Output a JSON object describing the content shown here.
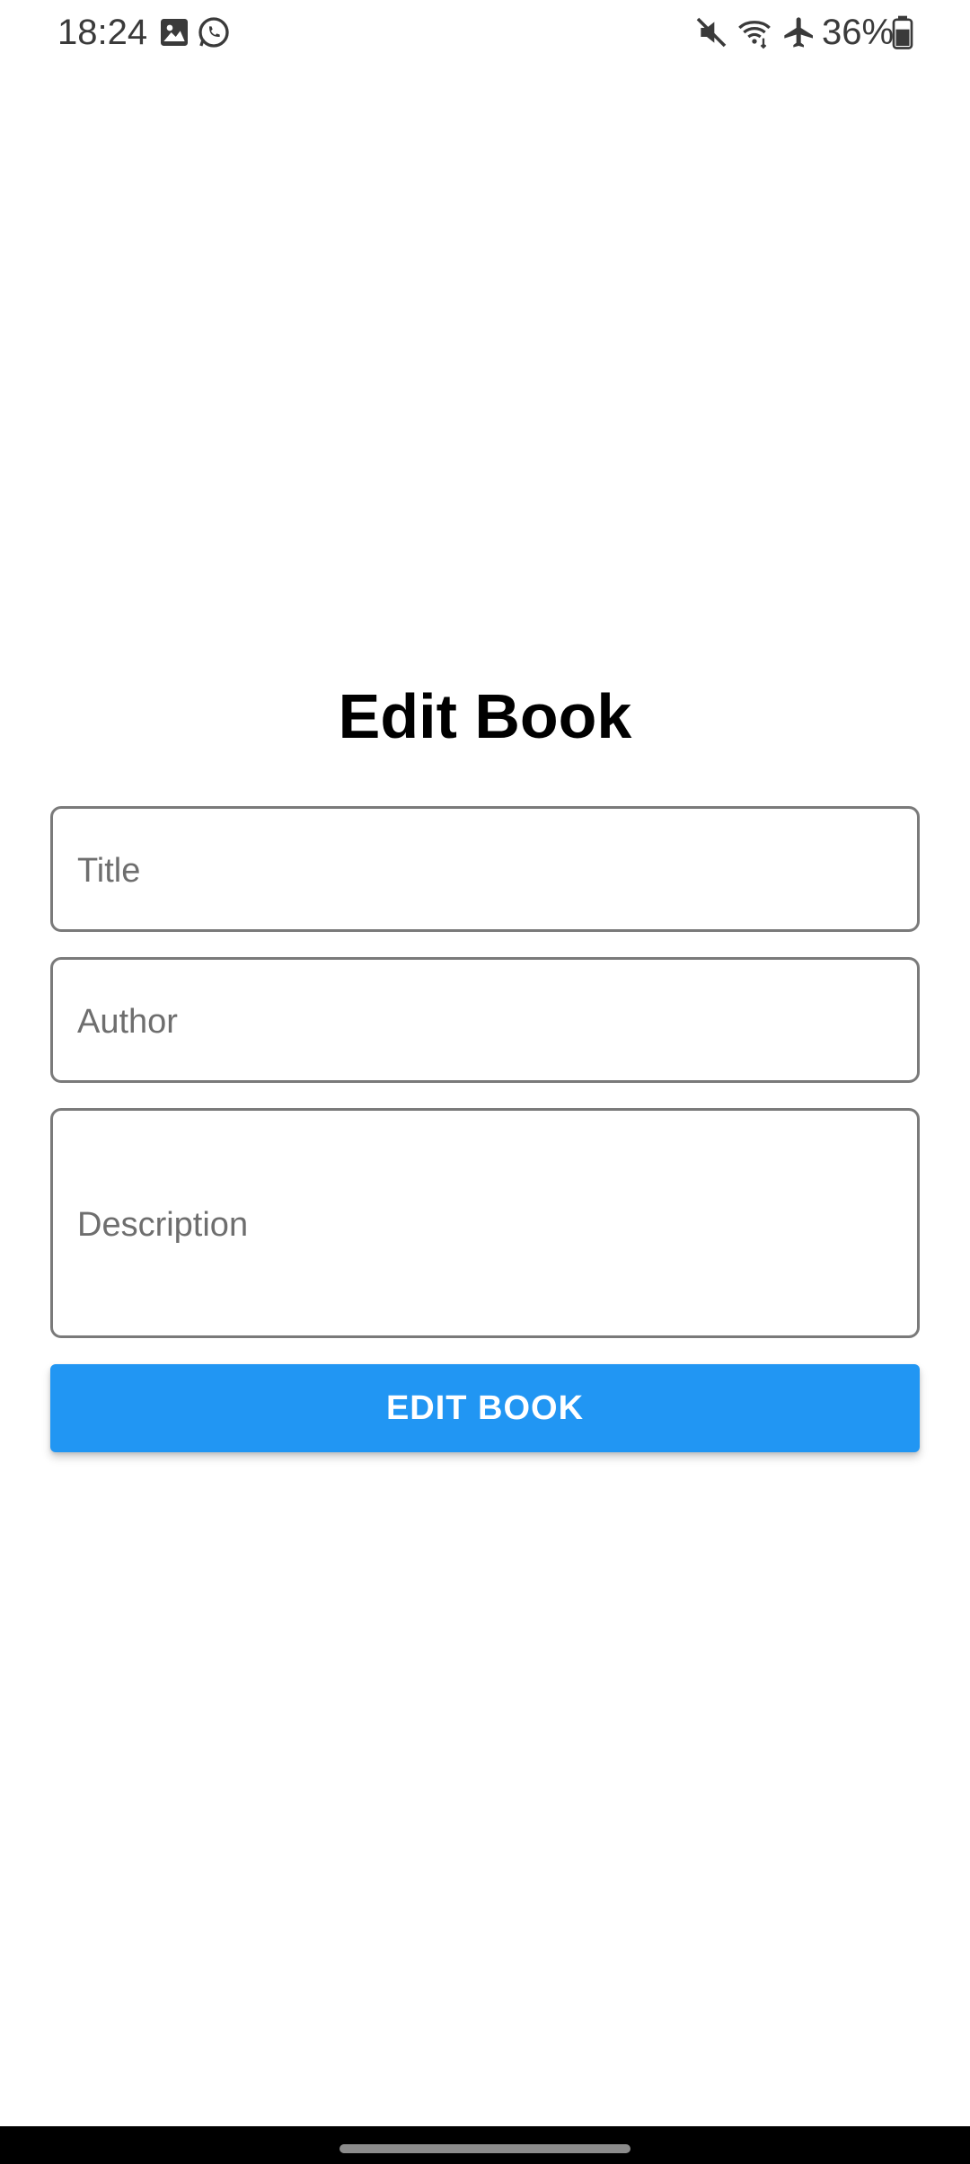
{
  "status_bar": {
    "time": "18:24",
    "battery_percent": "36%",
    "left_icons": [
      "image-icon",
      "whatsapp-icon"
    ],
    "right_icons": [
      "mute-icon",
      "wifi-icon",
      "airplane-mode-icon",
      "battery-icon"
    ]
  },
  "page": {
    "title": "Edit Book"
  },
  "form": {
    "title_placeholder": "Title",
    "author_placeholder": "Author",
    "description_placeholder": "Description",
    "submit_label": "EDIT BOOK"
  },
  "colors": {
    "button": "#2196f3",
    "field_border": "#7a7a7a",
    "placeholder": "#6e6e6e"
  }
}
